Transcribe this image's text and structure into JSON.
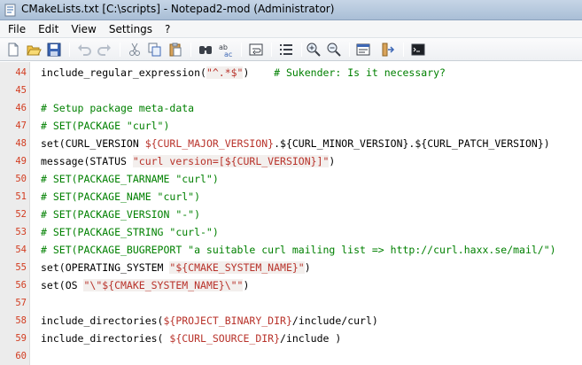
{
  "window": {
    "title": "CMakeLists.txt [C:\\scripts] - Notepad2-mod (Administrator)"
  },
  "menu": [
    "File",
    "Edit",
    "View",
    "Settings",
    "?"
  ],
  "toolbar": {
    "buttons": [
      "new-file",
      "open-file",
      "save-file",
      "undo",
      "redo",
      "cut",
      "copy",
      "paste",
      "find",
      "replace",
      "word-wrap",
      "line-numbers",
      "zoom-in",
      "zoom-out",
      "scheme",
      "go-to-line",
      "run"
    ]
  },
  "editor": {
    "lines": [
      {
        "num": "44",
        "tokens": [
          {
            "t": "include_regular_expression(",
            "c": "plain"
          },
          {
            "t": "\"^.*$\"",
            "c": "string-bg"
          },
          {
            "t": ")    ",
            "c": "plain"
          },
          {
            "t": "# Sukender: Is it necessary?",
            "c": "comment"
          }
        ]
      },
      {
        "num": "45",
        "tokens": []
      },
      {
        "num": "46",
        "tokens": [
          {
            "t": "# Setup package meta-data",
            "c": "comment"
          }
        ]
      },
      {
        "num": "47",
        "tokens": [
          {
            "t": "# SET(PACKAGE \"curl\")",
            "c": "comment"
          }
        ]
      },
      {
        "num": "48",
        "tokens": [
          {
            "t": "set(CURL_VERSION ",
            "c": "plain"
          },
          {
            "t": "${CURL_MAJOR_VERSION}",
            "c": "var"
          },
          {
            "t": ".${CURL_MINOR_VERSION}.${CURL_PATCH_VERSION})",
            "c": "plain"
          }
        ]
      },
      {
        "num": "49",
        "tokens": [
          {
            "t": "message(STATUS ",
            "c": "plain"
          },
          {
            "t": "\"curl version=[${CURL_VERSION}]\"",
            "c": "string-bg"
          },
          {
            "t": ")",
            "c": "plain"
          }
        ]
      },
      {
        "num": "50",
        "tokens": [
          {
            "t": "# SET(PACKAGE_TARNAME \"curl\")",
            "c": "comment"
          }
        ]
      },
      {
        "num": "51",
        "tokens": [
          {
            "t": "# SET(PACKAGE_NAME \"curl\")",
            "c": "comment"
          }
        ]
      },
      {
        "num": "52",
        "tokens": [
          {
            "t": "# SET(PACKAGE_VERSION \"-\")",
            "c": "comment"
          }
        ]
      },
      {
        "num": "53",
        "tokens": [
          {
            "t": "# SET(PACKAGE_STRING \"curl-\")",
            "c": "comment"
          }
        ]
      },
      {
        "num": "54",
        "tokens": [
          {
            "t": "# SET(PACKAGE_BUGREPORT \"a suitable curl mailing list => http://curl.haxx.se/mail/\")",
            "c": "comment"
          }
        ]
      },
      {
        "num": "55",
        "tokens": [
          {
            "t": "set(OPERATING_SYSTEM ",
            "c": "plain"
          },
          {
            "t": "\"${CMAKE_SYSTEM_NAME}\"",
            "c": "string-bg"
          },
          {
            "t": ")",
            "c": "plain"
          }
        ]
      },
      {
        "num": "56",
        "tokens": [
          {
            "t": "set(OS ",
            "c": "plain"
          },
          {
            "t": "\"\\\"${CMAKE_SYSTEM_NAME}\\\"\"",
            "c": "string-bg"
          },
          {
            "t": ")",
            "c": "plain"
          }
        ]
      },
      {
        "num": "57",
        "tokens": []
      },
      {
        "num": "58",
        "tokens": [
          {
            "t": "include_directories(",
            "c": "plain"
          },
          {
            "t": "${PROJECT_BINARY_DIR}",
            "c": "var"
          },
          {
            "t": "/include/curl)",
            "c": "plain"
          }
        ]
      },
      {
        "num": "59",
        "tokens": [
          {
            "t": "include_directories( ",
            "c": "plain"
          },
          {
            "t": "${CURL_SOURCE_DIR}",
            "c": "var"
          },
          {
            "t": "/include )",
            "c": "plain"
          }
        ]
      },
      {
        "num": "60",
        "tokens": []
      }
    ]
  },
  "colors": {
    "line_number": "#d23c20",
    "comment": "#008000",
    "string": "#b8322a",
    "plain": "#000000"
  }
}
